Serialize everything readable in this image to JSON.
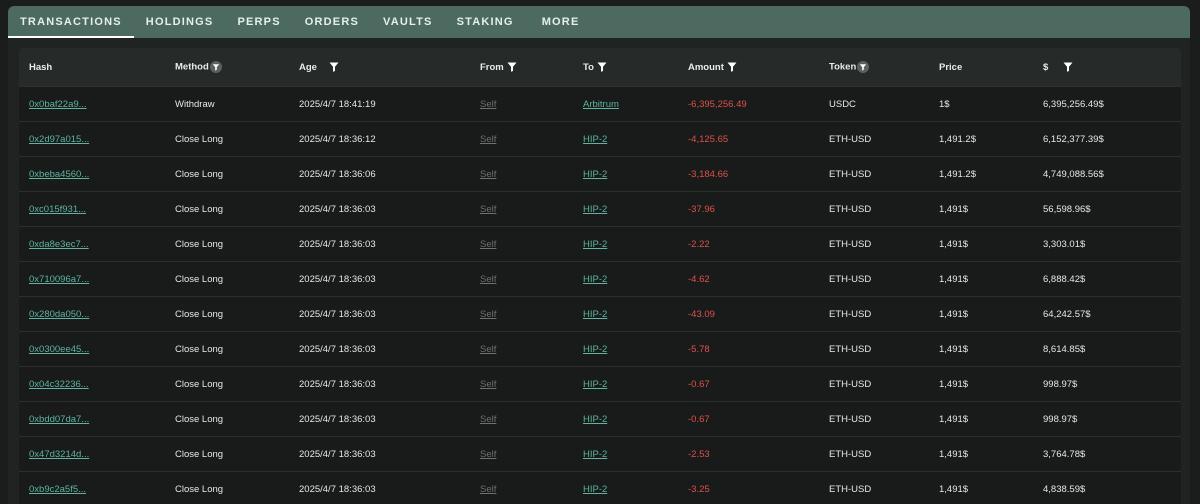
{
  "tabs": [
    {
      "label": "TRANSACTIONS",
      "active": true
    },
    {
      "label": "HOLDINGS"
    },
    {
      "label": "PERPS"
    },
    {
      "label": "ORDERS"
    },
    {
      "label": "VAULTS"
    },
    {
      "label": "STAKING"
    },
    {
      "label": "MORE"
    }
  ],
  "columns": {
    "hash": "Hash",
    "method": "Method",
    "age": "Age",
    "from": "From",
    "to": "To",
    "amount": "Amount",
    "token": "Token",
    "price": "Price",
    "usd": "$"
  },
  "rows": [
    {
      "hash": "0x0baf22a9...",
      "method": "Withdraw",
      "age": "2025/4/7 18:41:19",
      "from": "Self",
      "to": "Arbitrum",
      "amount": "-6,395,256.49",
      "token": "USDC",
      "price": "1$",
      "usd": "6,395,256.49$"
    },
    {
      "hash": "0x2d97a015...",
      "method": "Close Long",
      "age": "2025/4/7 18:36:12",
      "from": "Self",
      "to": "HIP-2",
      "amount": "-4,125.65",
      "token": "ETH-USD",
      "price": "1,491.2$",
      "usd": "6,152,377.39$"
    },
    {
      "hash": "0xbeba4560...",
      "method": "Close Long",
      "age": "2025/4/7 18:36:06",
      "from": "Self",
      "to": "HIP-2",
      "amount": "-3,184.66",
      "token": "ETH-USD",
      "price": "1,491.2$",
      "usd": "4,749,088.56$"
    },
    {
      "hash": "0xc015f931...",
      "method": "Close Long",
      "age": "2025/4/7 18:36:03",
      "from": "Self",
      "to": "HIP-2",
      "amount": "-37.96",
      "token": "ETH-USD",
      "price": "1,491$",
      "usd": "56,598.96$"
    },
    {
      "hash": "0xda8e3ec7...",
      "method": "Close Long",
      "age": "2025/4/7 18:36:03",
      "from": "Self",
      "to": "HIP-2",
      "amount": "-2.22",
      "token": "ETH-USD",
      "price": "1,491$",
      "usd": "3,303.01$"
    },
    {
      "hash": "0x710096a7...",
      "method": "Close Long",
      "age": "2025/4/7 18:36:03",
      "from": "Self",
      "to": "HIP-2",
      "amount": "-4.62",
      "token": "ETH-USD",
      "price": "1,491$",
      "usd": "6,888.42$"
    },
    {
      "hash": "0x280da050...",
      "method": "Close Long",
      "age": "2025/4/7 18:36:03",
      "from": "Self",
      "to": "HIP-2",
      "amount": "-43.09",
      "token": "ETH-USD",
      "price": "1,491$",
      "usd": "64,242.57$"
    },
    {
      "hash": "0x0300ee45...",
      "method": "Close Long",
      "age": "2025/4/7 18:36:03",
      "from": "Self",
      "to": "HIP-2",
      "amount": "-5.78",
      "token": "ETH-USD",
      "price": "1,491$",
      "usd": "8,614.85$"
    },
    {
      "hash": "0x04c32236...",
      "method": "Close Long",
      "age": "2025/4/7 18:36:03",
      "from": "Self",
      "to": "HIP-2",
      "amount": "-0.67",
      "token": "ETH-USD",
      "price": "1,491$",
      "usd": "998.97$"
    },
    {
      "hash": "0xbdd07da7...",
      "method": "Close Long",
      "age": "2025/4/7 18:36:03",
      "from": "Self",
      "to": "HIP-2",
      "amount": "-0.67",
      "token": "ETH-USD",
      "price": "1,491$",
      "usd": "998.97$"
    },
    {
      "hash": "0x47d3214d...",
      "method": "Close Long",
      "age": "2025/4/7 18:36:03",
      "from": "Self",
      "to": "HIP-2",
      "amount": "-2.53",
      "token": "ETH-USD",
      "price": "1,491$",
      "usd": "3,764.78$"
    },
    {
      "hash": "0xb9c2a5f5...",
      "method": "Close Long",
      "age": "2025/4/7 18:36:03",
      "from": "Self",
      "to": "HIP-2",
      "amount": "-3.25",
      "token": "ETH-USD",
      "price": "1,491$",
      "usd": "4,838.59$"
    }
  ],
  "colors": {
    "tabbar": "#4d6a60",
    "link": "#5fb3a0",
    "negative": "#e0504a",
    "muted_link": "#6b726f"
  },
  "icons": {
    "filter": "filter-icon",
    "filter_circle": "filter-circle-icon"
  }
}
